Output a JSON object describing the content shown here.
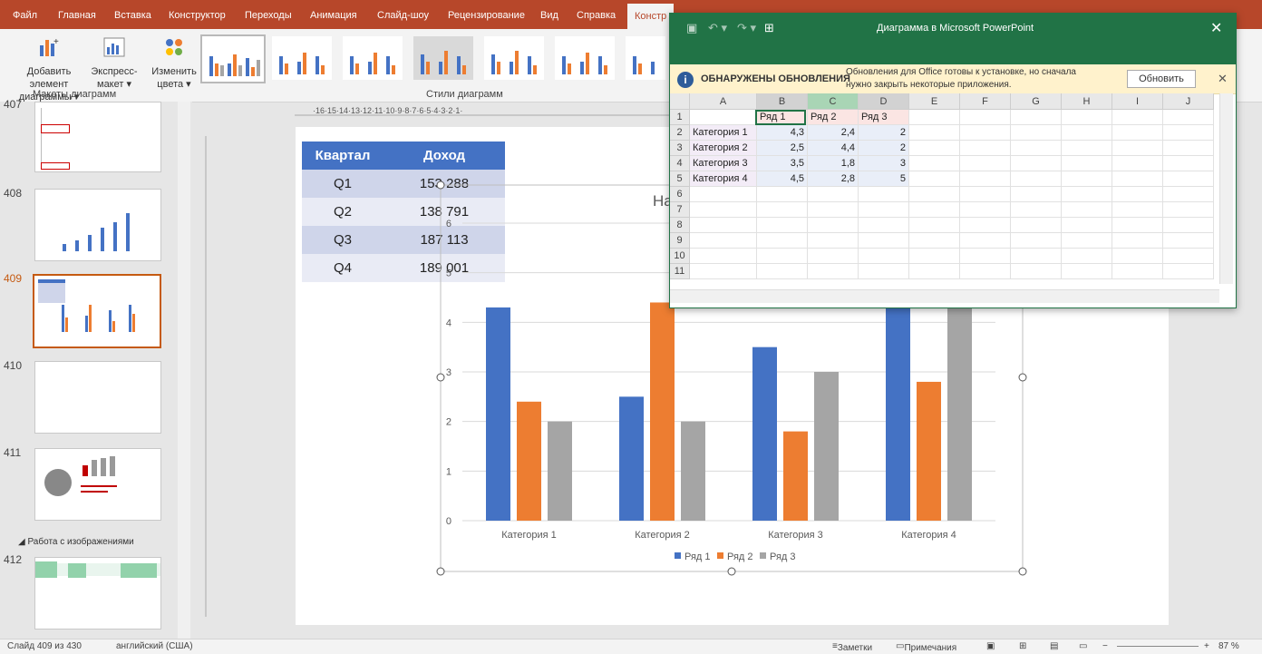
{
  "ribbon": {
    "tabs": [
      "Файл",
      "Главная",
      "Вставка",
      "Конструктор",
      "Переходы",
      "Анимация",
      "Слайд-шоу",
      "Рецензирование",
      "Вид",
      "Справка",
      "Констр"
    ],
    "buttons": {
      "add_element_line1": "Добавить элемент",
      "add_element_line2": "диаграммы",
      "quick_layout_line1": "Экспресс-",
      "quick_layout_line2": "макет",
      "change_colors_line1": "Изменить",
      "change_colors_line2": "цвета"
    },
    "groups": {
      "layouts": "Макеты диаграмм",
      "styles": "Стили диаграмм"
    }
  },
  "slides": {
    "items": [
      {
        "num": "407"
      },
      {
        "num": "408"
      },
      {
        "num": "409"
      },
      {
        "num": "410"
      },
      {
        "num": "411"
      },
      {
        "num": "412"
      }
    ],
    "section_label": "Работа с изображениями",
    "active": "409"
  },
  "slide_table": {
    "headers": [
      "Квартал",
      "Доход"
    ],
    "rows": [
      [
        "Q1",
        "153 288"
      ],
      [
        "Q2",
        "138 791"
      ],
      [
        "Q3",
        "187 113"
      ],
      [
        "Q4",
        "189 001"
      ]
    ]
  },
  "chart_title_partial": "На",
  "chart_data": {
    "type": "bar",
    "categories": [
      "Категория 1",
      "Категория 2",
      "Категория 3",
      "Категория 4"
    ],
    "series": [
      {
        "name": "Ряд 1",
        "values": [
          4.3,
          2.5,
          3.5,
          4.5
        ],
        "color": "#4472c4"
      },
      {
        "name": "Ряд 2",
        "values": [
          2.4,
          4.4,
          1.8,
          2.8
        ],
        "color": "#ed7d31"
      },
      {
        "name": "Ряд 3",
        "values": [
          2,
          2,
          3,
          5
        ],
        "color": "#a5a5a5"
      }
    ],
    "yticks": [
      "0",
      "1",
      "2",
      "3",
      "4",
      "5",
      "6"
    ],
    "ylim": [
      0,
      6
    ],
    "legend": "bottom",
    "grid": true
  },
  "excel": {
    "title": "Диаграмма в Microsoft PowerPoint",
    "info_title": "ОБНАРУЖЕНЫ ОБНОВЛЕНИЯ",
    "info_text_line1": "Обновления для Office готовы к установке, но сначала",
    "info_text_line2": "нужно закрыть некоторые приложения.",
    "update_button": "Обновить",
    "columns": [
      "A",
      "B",
      "C",
      "D",
      "E",
      "F",
      "G",
      "H",
      "I",
      "J"
    ],
    "rows": [
      "1",
      "2",
      "3",
      "4",
      "5",
      "6",
      "7",
      "8",
      "9",
      "10",
      "11"
    ],
    "data": [
      [
        "",
        "Ряд 1",
        "Ряд 2",
        "Ряд 3"
      ],
      [
        "Категория 1",
        "4,3",
        "2,4",
        "2"
      ],
      [
        "Категория 2",
        "2,5",
        "4,4",
        "2"
      ],
      [
        "Категория 3",
        "3,5",
        "1,8",
        "3"
      ],
      [
        "Категория 4",
        "4,5",
        "2,8",
        "5"
      ]
    ]
  },
  "status": {
    "slide": "Слайд 409 из 430",
    "language": "английский (США)",
    "notes": "Заметки",
    "comments": "Примечания",
    "zoom": "87 %"
  },
  "colors": {
    "accent": "#b7472a",
    "excel": "#217346",
    "active_slide": "#c55a11"
  }
}
